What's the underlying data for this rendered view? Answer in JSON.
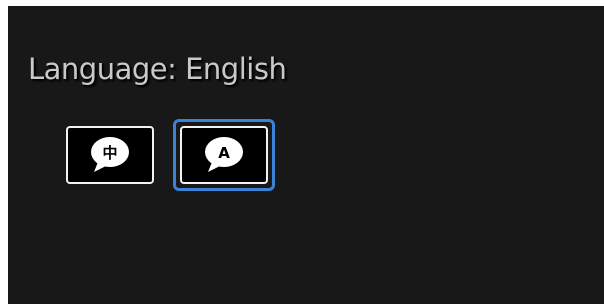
{
  "title": "Language: English",
  "languages": [
    {
      "glyph": "中",
      "icon": "speech-bubble-icon",
      "selected": false
    },
    {
      "glyph": "A",
      "icon": "speech-bubble-icon",
      "selected": true
    }
  ],
  "colors": {
    "background": "#181818",
    "title_text": "#c9c9c9",
    "button_background": "#000000",
    "button_border": "#f2f2f2",
    "focus_ring": "#3b82d6"
  }
}
